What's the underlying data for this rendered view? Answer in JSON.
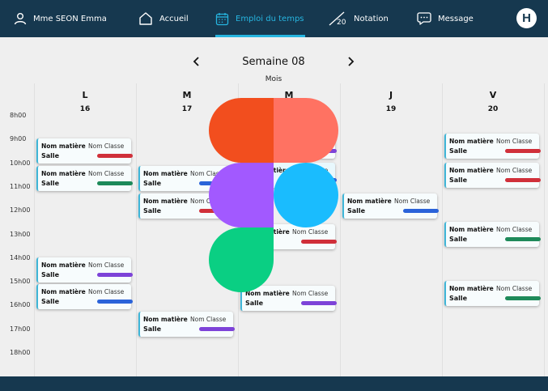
{
  "nav": {
    "user": {
      "label": "Mme SEON Emma",
      "icon": "user-icon"
    },
    "home": {
      "label": "Accueil",
      "icon": "home-icon"
    },
    "timetable": {
      "label": "Emploi du temps",
      "icon": "calendar-icon",
      "active": true
    },
    "grades": {
      "label": "Notation",
      "icon": "grade-icon",
      "icon_text": "20"
    },
    "messages": {
      "label": "Message",
      "icon": "chat-icon"
    },
    "logo": {
      "text": "H"
    }
  },
  "week": {
    "title": "Semaine 08",
    "month_toggle": "Mois"
  },
  "days": [
    {
      "letter": "L",
      "number": "16"
    },
    {
      "letter": "M",
      "number": "17"
    },
    {
      "letter": "M",
      "number": "18"
    },
    {
      "letter": "J",
      "number": "19"
    },
    {
      "letter": "V",
      "number": "20"
    }
  ],
  "hours": [
    "8h00",
    "9h00",
    "10h00",
    "11h00",
    "12h00",
    "13h00",
    "14h00",
    "15h00",
    "16h00",
    "17h00",
    "18h00"
  ],
  "events": [
    {
      "day": 0,
      "start": 9.0,
      "subject": "Nom matière",
      "class": "Nom Classe",
      "room": "Salle",
      "color": "#d0303a"
    },
    {
      "day": 0,
      "start": 10.15,
      "subject": "Nom matière",
      "class": "Nom Classe",
      "room": "Salle",
      "color": "#1e8a5a"
    },
    {
      "day": 0,
      "start": 14.0,
      "subject": "Nom matière",
      "class": "Nom Classe",
      "room": "Salle",
      "color": "#7d43d8"
    },
    {
      "day": 0,
      "start": 15.15,
      "subject": "Nom matière",
      "class": "Nom Classe",
      "room": "Salle",
      "color": "#2b63d9"
    },
    {
      "day": 1,
      "start": 10.15,
      "subject": "Nom matière",
      "class": "Nom Classe",
      "room": "Salle",
      "color": "#2b63d9"
    },
    {
      "day": 1,
      "start": 11.3,
      "subject": "Nom matière",
      "class": "Nom Classe",
      "room": "Salle",
      "color": "#d0303a"
    },
    {
      "day": 1,
      "start": 16.3,
      "subject": "Nom matière",
      "class": "Nom Classe",
      "room": "Salle",
      "color": "#7d43d8"
    },
    {
      "day": 2,
      "start": 8.8,
      "subject": "Nom matière",
      "class": "Nom Classe",
      "room": "Salle",
      "color": "#7d43d8"
    },
    {
      "day": 2,
      "start": 10.0,
      "subject": "Nom matière",
      "class": "Nom Classe",
      "room": "Salle",
      "color": "#2b63d9",
      "highlight": true
    },
    {
      "day": 2,
      "start": 12.6,
      "subject": "Nom matière",
      "class": "Nom Classe",
      "room": "Salle",
      "color": "#d0303a"
    },
    {
      "day": 2,
      "start": 15.2,
      "subject": "Nom matière",
      "class": "Nom Classe",
      "room": "Salle",
      "color": "#7d43d8"
    },
    {
      "day": 3,
      "start": 11.3,
      "subject": "Nom matière",
      "class": "Nom Classe",
      "room": "Salle",
      "color": "#2b63d9"
    },
    {
      "day": 4,
      "start": 8.8,
      "subject": "Nom matière",
      "class": "Nom Classe",
      "room": "Salle",
      "color": "#d0303a"
    },
    {
      "day": 4,
      "start": 10.0,
      "subject": "Nom matière",
      "class": "Nom Classe",
      "room": "Salle",
      "color": "#d0303a"
    },
    {
      "day": 4,
      "start": 12.5,
      "subject": "Nom matière",
      "class": "Nom Classe",
      "room": "Salle",
      "color": "#1e8a5a"
    },
    {
      "day": 4,
      "start": 15.0,
      "subject": "Nom matière",
      "class": "Nom Classe",
      "room": "Salle",
      "color": "#1e8a5a"
    }
  ],
  "overlay": {
    "icon": "figma-logo-icon"
  },
  "colors": {
    "nav_bg": "#16384f",
    "accent": "#26b5e0"
  }
}
